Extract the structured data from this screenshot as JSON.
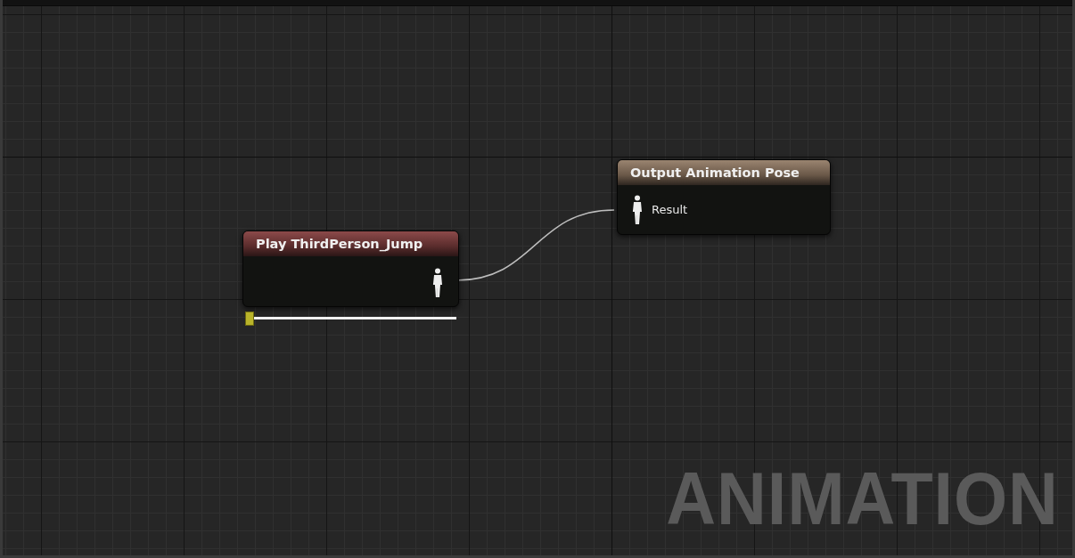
{
  "graph": {
    "nodes": [
      {
        "kind": "player",
        "title": "Play ThirdPerson_Jump",
        "playback": {
          "level": 0.0
        }
      },
      {
        "kind": "output",
        "title": "Output Animation Pose",
        "pin_label": "Result"
      }
    ],
    "watermark_label": "ANIMATION"
  }
}
